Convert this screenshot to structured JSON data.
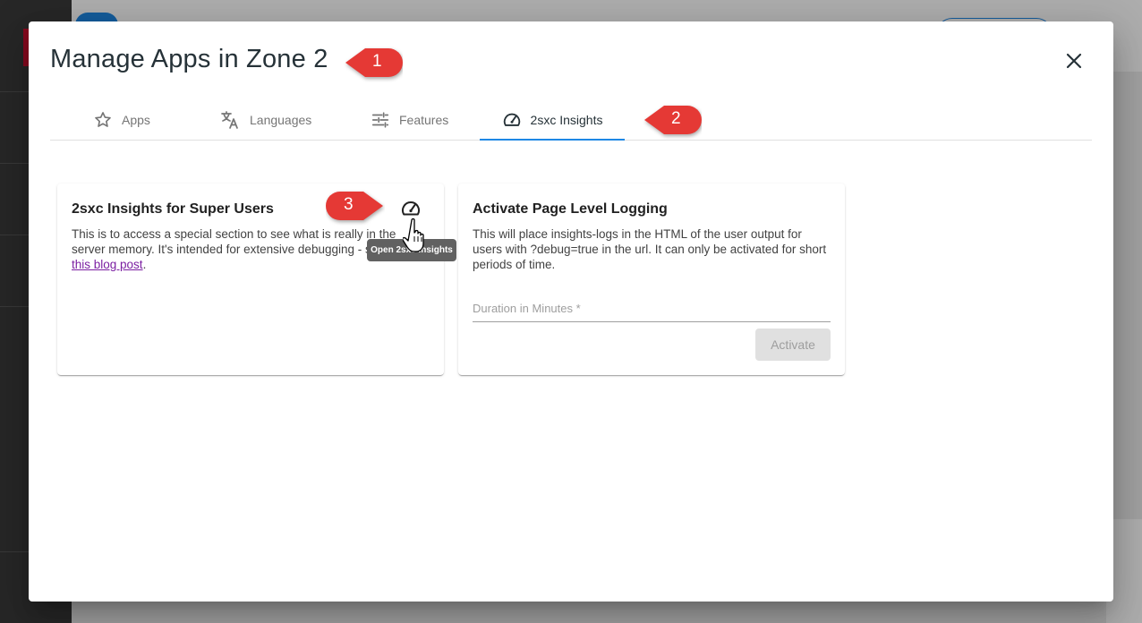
{
  "dialog": {
    "title": "Manage Apps in Zone 2"
  },
  "tabs": [
    {
      "label": "Apps",
      "icon": "star-outline-icon",
      "active": false
    },
    {
      "label": "Languages",
      "icon": "translate-icon",
      "active": false
    },
    {
      "label": "Features",
      "icon": "tune-icon",
      "active": false
    },
    {
      "label": "2sxc Insights",
      "icon": "speedometer-icon",
      "active": true
    }
  ],
  "insights_card": {
    "title": "2sxc Insights for Super Users",
    "text_before_link": "This is to access a special section to see what is really in the server memory. It's intended for extensive debugging - see also ",
    "link_text": "this blog post",
    "text_after_link": ".",
    "button_icon": "speedometer-icon",
    "tooltip": "Open 2sxc Insights"
  },
  "logging_card": {
    "title": "Activate Page Level Logging",
    "text": "This will place insights-logs in the HTML of the user output for users with ?debug=true in the url. It can only be activated for short periods of time.",
    "field_label": "Duration in Minutes *",
    "field_value": "",
    "button_label": "Activate"
  },
  "callouts": [
    "1",
    "2",
    "3"
  ],
  "colors": {
    "accent": "#1e88e5",
    "callout": "#e53935",
    "link": "#7b1fa2"
  }
}
